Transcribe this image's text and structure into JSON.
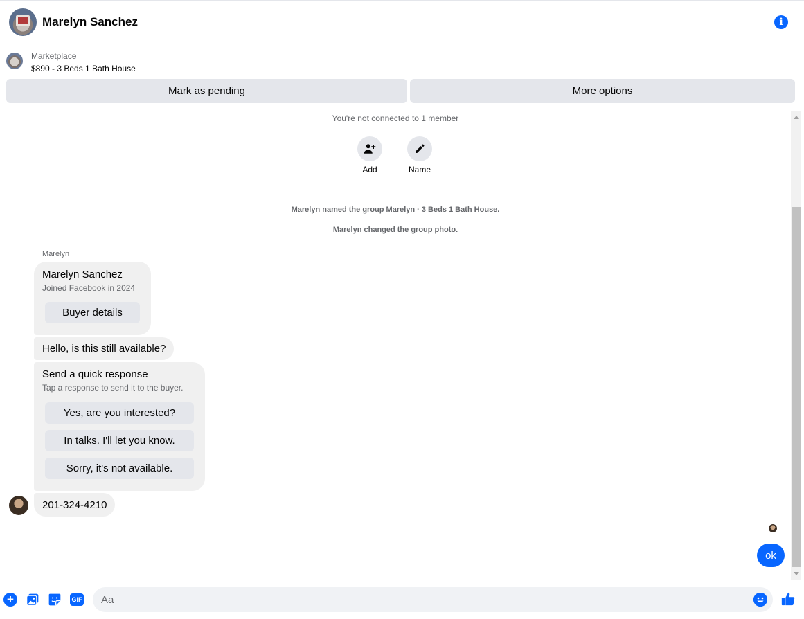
{
  "header": {
    "contact_name": "Marelyn Sanchez",
    "info_icon": "info-icon",
    "info_glyph": "i"
  },
  "marketplace": {
    "label": "Marketplace",
    "listing": "$890 - 3 Beds 1 Bath House",
    "buttons": {
      "mark_pending": "Mark as pending",
      "more_options": "More options"
    }
  },
  "chat": {
    "not_connected": "You're not connected to 1 member",
    "actions": {
      "add": "Add",
      "name": "Name"
    },
    "system_messages": [
      "Marelyn named the group Marelyn · 3 Beds 1 Bath House.",
      "Marelyn changed the group photo."
    ],
    "sender_name": "Marelyn",
    "profile_card": {
      "name": "Marelyn Sanchez",
      "joined": "Joined Facebook in 2024",
      "button": "Buyer details"
    },
    "message_hello": "Hello, is this still available?",
    "quick_response": {
      "title": "Send a quick response",
      "subtitle": "Tap a response to send it to the buyer.",
      "options": [
        "Yes, are you interested?",
        "In talks. I'll let you know.",
        "Sorry, it's not available."
      ]
    },
    "message_phone": "201-324-4210",
    "my_message": "ok"
  },
  "composer": {
    "placeholder": "Aa",
    "gif_label": "GIF",
    "plus_glyph": "+"
  },
  "colors": {
    "accent": "#0866ff",
    "bubble_gray": "#f0f0f0",
    "button_gray": "#e4e6eb",
    "secondary_text": "#65676b"
  }
}
